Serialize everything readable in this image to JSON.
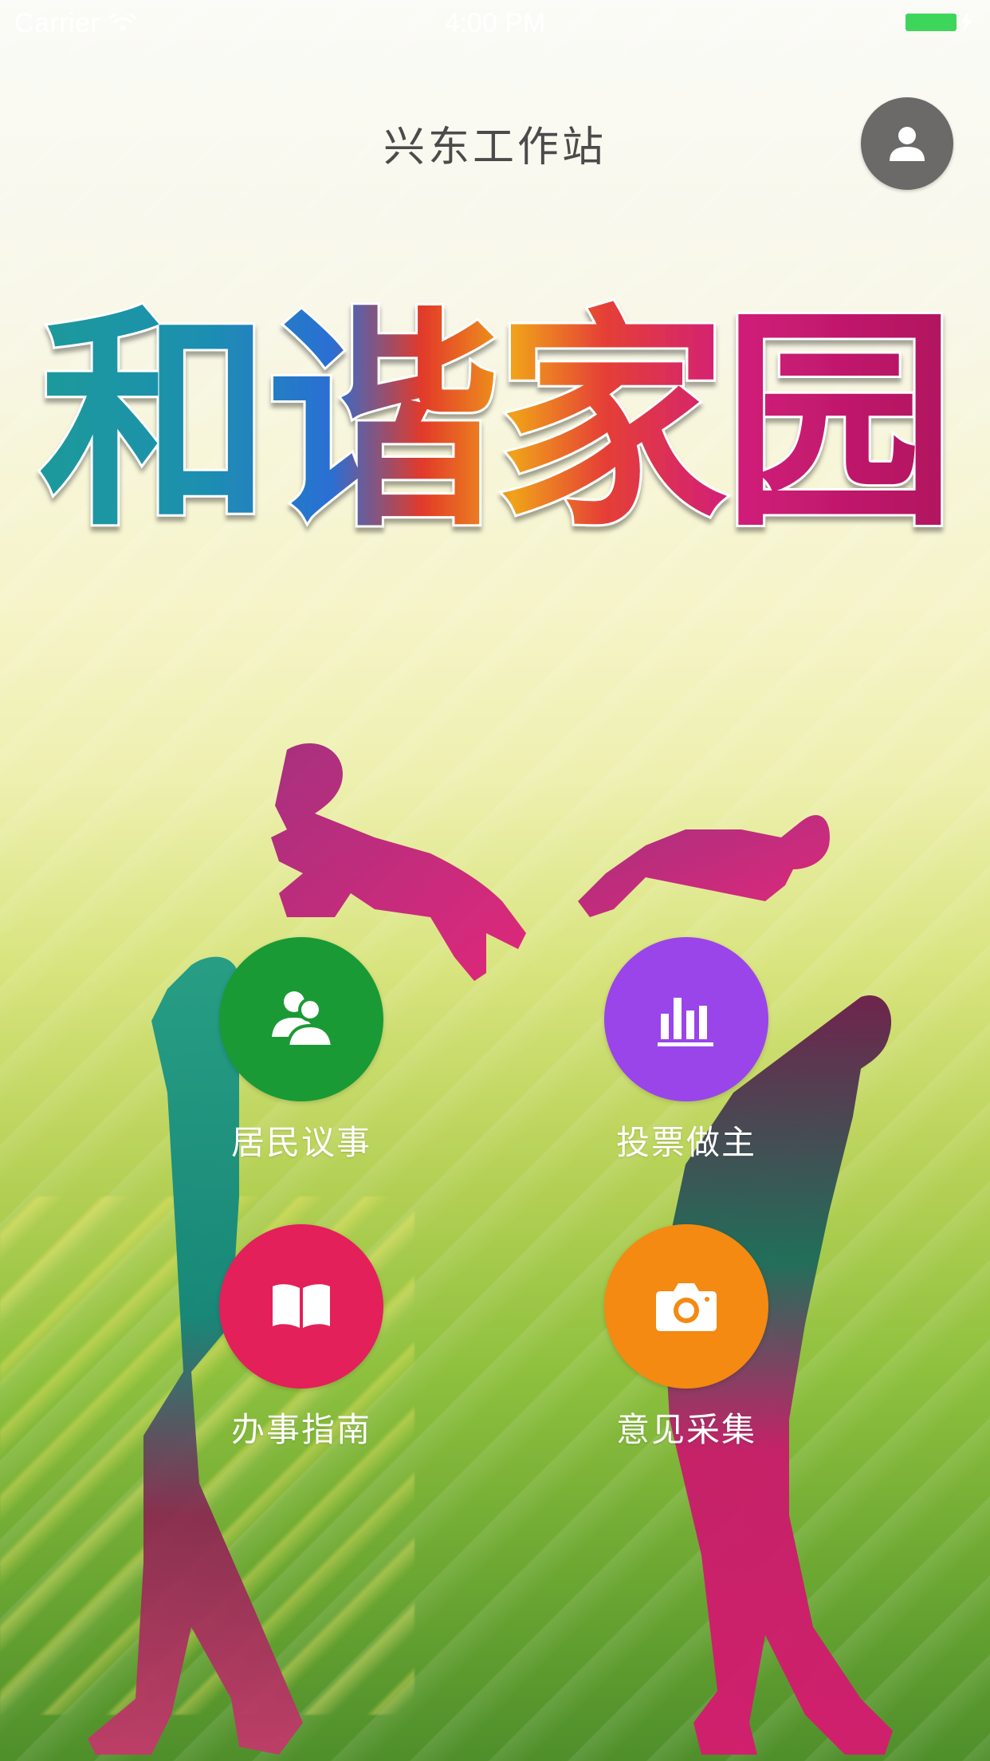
{
  "status_bar": {
    "carrier": "Carrier",
    "time": "4:00 PM",
    "wifi_icon": "wifi-icon",
    "battery_icon": "battery-icon",
    "battery_color": "#3dd65a"
  },
  "header": {
    "title": "兴东工作站",
    "profile_icon": "user-icon",
    "profile_bg": "#6b6a68"
  },
  "hero": {
    "logo_text": "和谐家园"
  },
  "actions": [
    {
      "label": "居民议事",
      "icon": "people-icon",
      "color": "#1a9a35"
    },
    {
      "label": "投票做主",
      "icon": "bar-chart-icon",
      "color": "#9a45ea"
    },
    {
      "label": "办事指南",
      "icon": "book-icon",
      "color": "#e3205a"
    },
    {
      "label": "意见采集",
      "icon": "camera-icon",
      "color": "#f48a12"
    }
  ]
}
